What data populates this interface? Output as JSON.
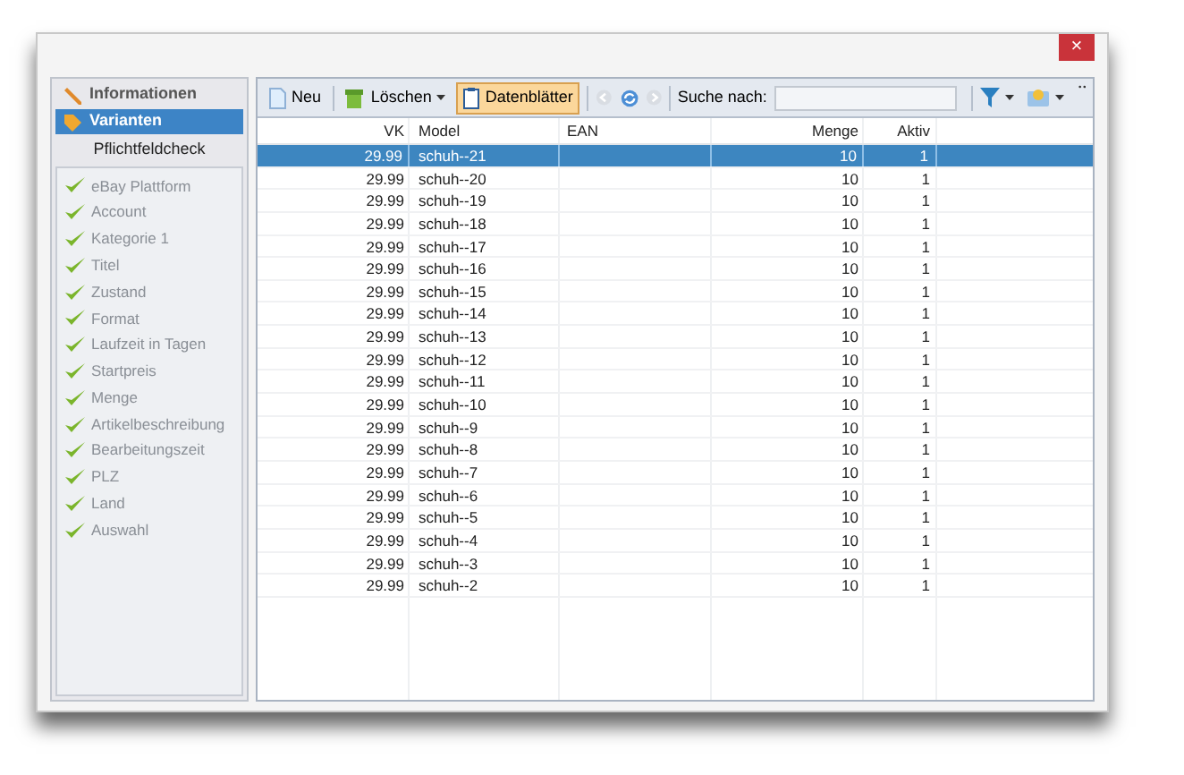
{
  "window": {
    "close_label": "×"
  },
  "nav": [
    {
      "label": "Informationen",
      "selected": false,
      "kind": "pencil"
    },
    {
      "label": "Varianten",
      "selected": true,
      "kind": "tag"
    }
  ],
  "check_title": "Pflichtfeldcheck",
  "checks": [
    {
      "label": "eBay Plattform",
      "checked": true
    },
    {
      "label": "Account",
      "checked": true
    },
    {
      "label": "Kategorie 1",
      "checked": true
    },
    {
      "label": "Titel",
      "checked": true
    },
    {
      "label": "Zustand",
      "checked": true
    },
    {
      "label": "Format",
      "checked": true
    },
    {
      "label": "Laufzeit in Tagen",
      "checked": true
    },
    {
      "label": "Startpreis",
      "checked": true
    },
    {
      "label": "Menge",
      "checked": true
    },
    {
      "label": "Artikelbeschreibung",
      "checked": true
    },
    {
      "label": "Bearbeitungszeit",
      "checked": true
    },
    {
      "label": "PLZ",
      "checked": true
    },
    {
      "label": "Land",
      "checked": true
    },
    {
      "label": "Auswahl",
      "checked": true
    }
  ],
  "toolbar": {
    "new": "Neu",
    "delete": "Löschen",
    "sheets": {
      "label": "Datenblätter",
      "selected": true
    },
    "search_label": "Suche nach:"
  },
  "table": {
    "columns": [
      "VK",
      "Model",
      "EAN",
      "Menge",
      "Aktiv"
    ],
    "rows": [
      {
        "cells": [
          "29.99",
          "schuh--21",
          "",
          "10",
          "1"
        ],
        "selected": true
      },
      {
        "cells": [
          "29.99",
          "schuh--20",
          "",
          "10",
          "1"
        ],
        "selected": false
      },
      {
        "cells": [
          "29.99",
          "schuh--19",
          "",
          "10",
          "1"
        ],
        "selected": false
      },
      {
        "cells": [
          "29.99",
          "schuh--18",
          "",
          "10",
          "1"
        ],
        "selected": false
      },
      {
        "cells": [
          "29.99",
          "schuh--17",
          "",
          "10",
          "1"
        ],
        "selected": false
      },
      {
        "cells": [
          "29.99",
          "schuh--16",
          "",
          "10",
          "1"
        ],
        "selected": false
      },
      {
        "cells": [
          "29.99",
          "schuh--15",
          "",
          "10",
          "1"
        ],
        "selected": false
      },
      {
        "cells": [
          "29.99",
          "schuh--14",
          "",
          "10",
          "1"
        ],
        "selected": false
      },
      {
        "cells": [
          "29.99",
          "schuh--13",
          "",
          "10",
          "1"
        ],
        "selected": false
      },
      {
        "cells": [
          "29.99",
          "schuh--12",
          "",
          "10",
          "1"
        ],
        "selected": false
      },
      {
        "cells": [
          "29.99",
          "schuh--11",
          "",
          "10",
          "1"
        ],
        "selected": false
      },
      {
        "cells": [
          "29.99",
          "schuh--10",
          "",
          "10",
          "1"
        ],
        "selected": false
      },
      {
        "cells": [
          "29.99",
          "schuh--9",
          "",
          "10",
          "1"
        ],
        "selected": false
      },
      {
        "cells": [
          "29.99",
          "schuh--8",
          "",
          "10",
          "1"
        ],
        "selected": false
      },
      {
        "cells": [
          "29.99",
          "schuh--7",
          "",
          "10",
          "1"
        ],
        "selected": false
      },
      {
        "cells": [
          "29.99",
          "schuh--6",
          "",
          "10",
          "1"
        ],
        "selected": false
      },
      {
        "cells": [
          "29.99",
          "schuh--5",
          "",
          "10",
          "1"
        ],
        "selected": false
      },
      {
        "cells": [
          "29.99",
          "schuh--4",
          "",
          "10",
          "1"
        ],
        "selected": false
      },
      {
        "cells": [
          "29.99",
          "schuh--3",
          "",
          "10",
          "1"
        ],
        "selected": false
      },
      {
        "cells": [
          "29.99",
          "schuh--2",
          "",
          "10",
          "1"
        ],
        "selected": false
      }
    ]
  }
}
